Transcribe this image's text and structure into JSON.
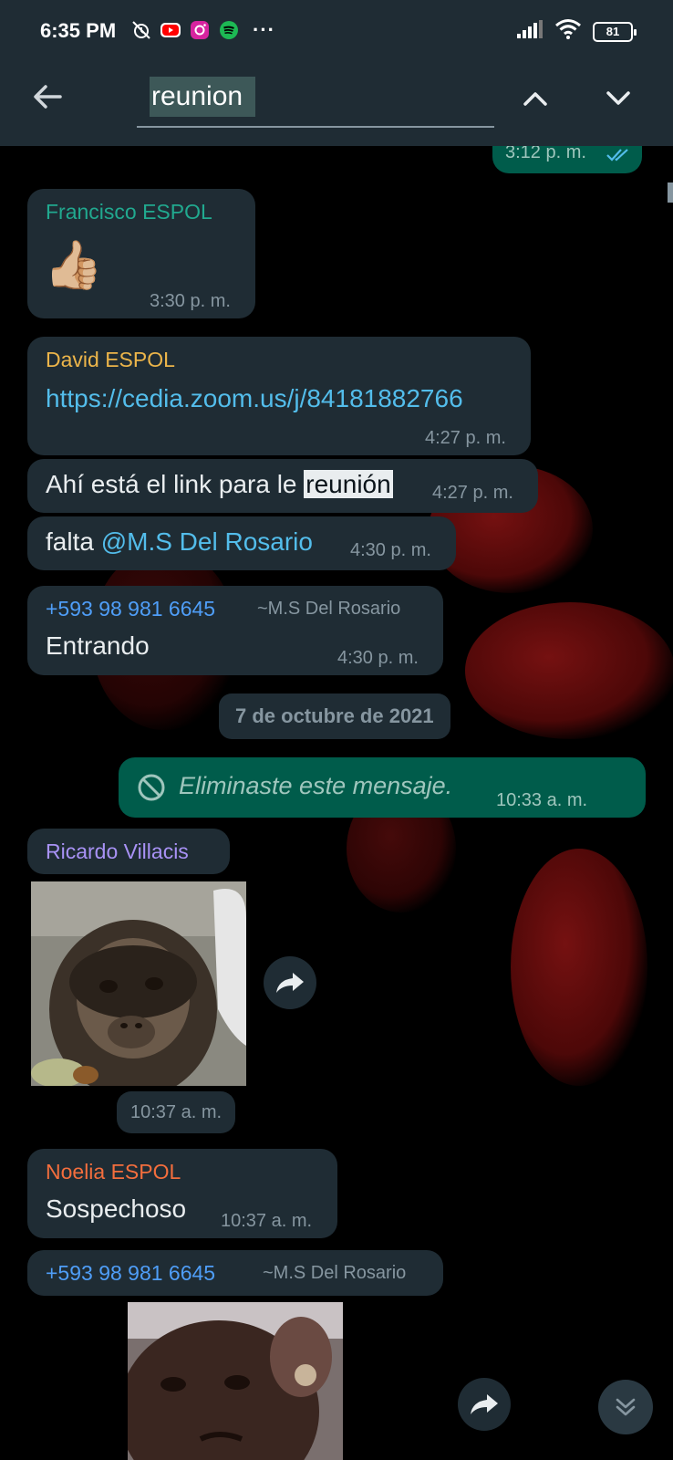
{
  "status_bar": {
    "time": "6:35 PM",
    "more": "···",
    "battery": "81"
  },
  "search": {
    "query": "reunion"
  },
  "colors": {
    "header_bg": "#1f2c34",
    "incoming_bubble": "#1f2c34",
    "outgoing_bubble": "#005c4b",
    "link": "#53bdeb",
    "sender_francisco": "#21a98f",
    "sender_david": "#ecb54a",
    "sender_phone": "#4f9ef8",
    "sender_ricardo": "#a892f5",
    "sender_noelia": "#f36e3d"
  },
  "messages": {
    "m0": {
      "time": "3:12 p. m."
    },
    "m1": {
      "sender": "Francisco ESPOL",
      "emoji": "👍🏼",
      "time": "3:30 p. m."
    },
    "m2": {
      "sender": "David ESPOL",
      "link": "https://cedia.zoom.us/j/84181882766",
      "time": "4:27 p. m."
    },
    "m3": {
      "text_before": "Ahí está el link para le ",
      "highlight": "reunión",
      "time": "4:27 p. m."
    },
    "m4": {
      "text_before": "falta ",
      "mention": "@M.S Del Rosario",
      "time": "4:30 p. m."
    },
    "m5": {
      "sender": "+593 98 981 6645",
      "sender_alias": "~M.S Del Rosario",
      "text": "Entrando",
      "time": "4:30 p. m."
    },
    "date_divider": "7 de octubre de 2021",
    "m6": {
      "text": "Eliminaste este mensaje.",
      "time": "10:33 a. m."
    },
    "m7": {
      "sender": "Ricardo Villacis",
      "time": "10:37 a. m."
    },
    "m8": {
      "sender": "Noelia ESPOL",
      "text": "Sospechoso",
      "time": "10:37 a. m."
    },
    "m9": {
      "sender": "+593 98 981 6645",
      "sender_alias": "~M.S Del Rosario"
    }
  }
}
